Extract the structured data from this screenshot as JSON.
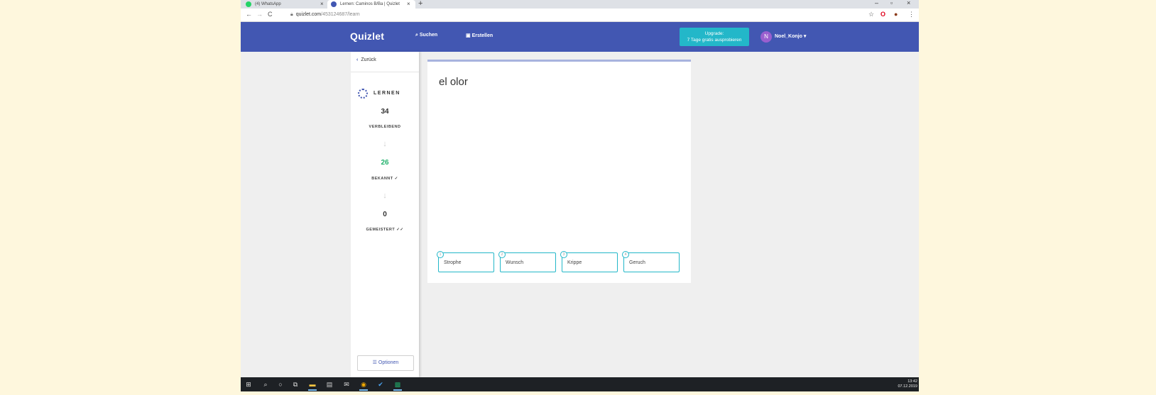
{
  "browser": {
    "tabs": [
      {
        "label": "(4) WhatsApp",
        "active": false
      },
      {
        "label": "Lernen: Caminos B/Ba | Quizlet",
        "active": true
      }
    ],
    "url_host": "quizlet.com",
    "url_path": "/453124687/learn"
  },
  "header": {
    "logo": "Quizlet",
    "search_label": "Suchen",
    "create_label": "Erstellen",
    "upgrade_line1": "Upgrade:",
    "upgrade_line2": "7 Tage gratis ausprobieren",
    "avatar_initial": "N",
    "username": "Noel_Konjo"
  },
  "sidebar": {
    "back_label": "Zurück",
    "mode_label": "LERNEN",
    "remaining_count": "34",
    "remaining_label": "VERBLEIBEND",
    "known_count": "26",
    "known_label": "BEKANNT ✓",
    "mastered_count": "0",
    "mastered_label": "GEMEISTERT ✓✓",
    "options_label": "Optionen"
  },
  "card": {
    "term": "el olor",
    "choices": [
      {
        "num": "1",
        "label": "Strophe"
      },
      {
        "num": "2",
        "label": "Wunsch"
      },
      {
        "num": "3",
        "label": "Krippe"
      },
      {
        "num": "4",
        "label": "Geruch"
      }
    ]
  },
  "taskbar": {
    "time": "13:42",
    "date": "07.12.2019"
  },
  "colors": {
    "brand": "#4257b2",
    "teal": "#23b7c9",
    "known_green": "#23b26d"
  }
}
